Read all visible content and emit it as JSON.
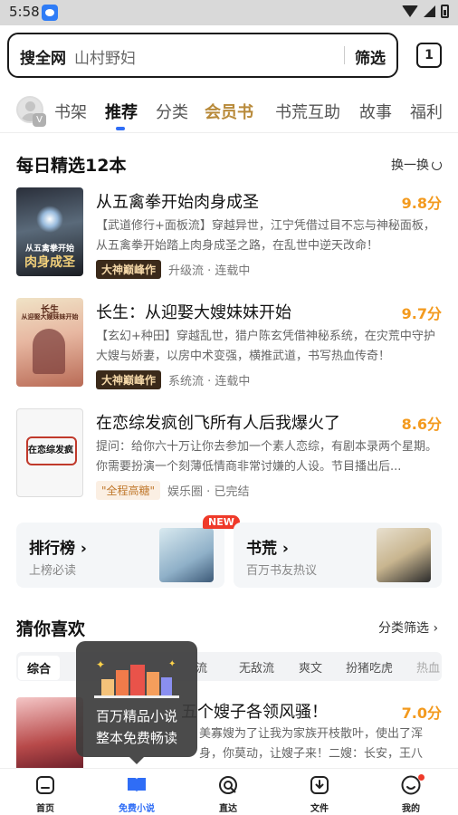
{
  "status_bar": {
    "time": "5:58"
  },
  "search": {
    "scope": "搜全网",
    "query": "山村野妇",
    "filter": "筛选",
    "tab_count": "1"
  },
  "channel_tabs": [
    {
      "label": "书架"
    },
    {
      "label": "推荐"
    },
    {
      "label": "分类"
    },
    {
      "label": "会员书"
    },
    {
      "label": "书荒互助"
    },
    {
      "label": "故事"
    },
    {
      "label": "福利"
    }
  ],
  "avatar_badge": "V",
  "daily": {
    "title": "每日精选12本",
    "action": "换一换",
    "books": [
      {
        "title": "从五禽拳开始肉身成圣",
        "score": "9.8分",
        "desc": "【武道修行+面板流】穿越异世，江宁凭借过目不忘与神秘面板，从五禽拳开始踏上肉身成圣之路，在乱世中逆天改命！",
        "tag": "大神巅峰作",
        "meta": "升级流 · 连载中",
        "cover_text": "肉身成圣",
        "cover_sub": "从五禽拳开始"
      },
      {
        "title": "长生：从迎娶大嫂妹妹开始",
        "score": "9.7分",
        "desc": "【玄幻+种田】穿越乱世，猎户陈玄凭借神秘系统，在灾荒中守护大嫂与娇妻，以房中术变强，横推武道，书写热血传奇！",
        "tag": "大神巅峰作",
        "meta": "系统流 · 连载中",
        "cover_text": "长生",
        "cover_sub": "从迎娶大嫂妹妹开始"
      },
      {
        "title": "在恋综发疯创飞所有人后我爆火了",
        "score": "8.6分",
        "desc": "提问：给你六十万让你去参加一个素人恋综，有剧本录两个星期。你需要扮演一个刻薄低情商非常讨嫌的人设。节目播出后...",
        "tag": "\"全程高糖\"",
        "meta": "娱乐圈 · 已完结",
        "cover_text": "在恋综发疯"
      }
    ]
  },
  "cards": [
    {
      "title": "排行榜",
      "sub": "上榜必读",
      "badge": "NEW"
    },
    {
      "title": "书荒",
      "sub": "百万书友热议"
    }
  ],
  "guess": {
    "title": "猜你喜欢",
    "action": "分类筛选",
    "chips": [
      "综合",
      "流",
      "无敌流",
      "爽文",
      "扮猪吃虎",
      "热血"
    ],
    "book": {
      "title": "五个嫂子各领风骚！",
      "score": "7.0分",
      "desc": "美寡嫂为了让我为家族开枝散叶，使出了浑身，你莫动，让嫂子来！二嫂：长安，王八汤..."
    }
  },
  "tooltip": {
    "line1": "百万精品小说",
    "line2": "整本免费畅读"
  },
  "bottom_nav": [
    {
      "label": "首页"
    },
    {
      "label": "免费小说"
    },
    {
      "label": "直达"
    },
    {
      "label": "文件"
    },
    {
      "label": "我的"
    }
  ],
  "colors": {
    "accent_blue": "#2f6df6",
    "score_orange": "#f39a1e",
    "vip_gold": "#b88a3a",
    "new_red": "#ef3a2a"
  }
}
